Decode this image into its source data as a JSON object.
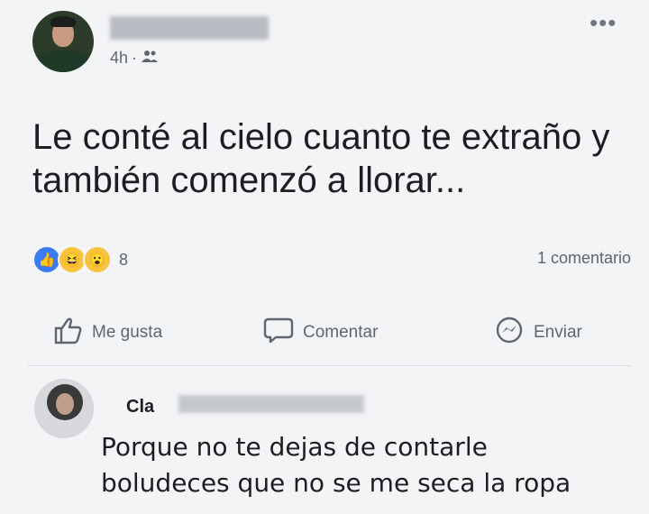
{
  "post": {
    "time": "4h",
    "dot": "·",
    "audience_icon": "friends-icon",
    "more_label": "•••",
    "text": "Le conté al cielo cuanto te extraño y también comenzó a llorar...",
    "reactions": {
      "icons": [
        "like-icon",
        "haha-icon",
        "wow-icon"
      ],
      "count": "8"
    },
    "comments_count_label": "1 comentario"
  },
  "actions": {
    "like_label": "Me gusta",
    "comment_label": "Comentar",
    "share_label": "Enviar"
  },
  "comment": {
    "author_visible": "Cla",
    "text": "Porque no te dejas de contarle boludeces que no se me seca la ropa"
  },
  "colors": {
    "accent_like": "#3b7bf2",
    "reaction_yellow": "#f7c33c",
    "secondary_text": "#5f6670"
  }
}
